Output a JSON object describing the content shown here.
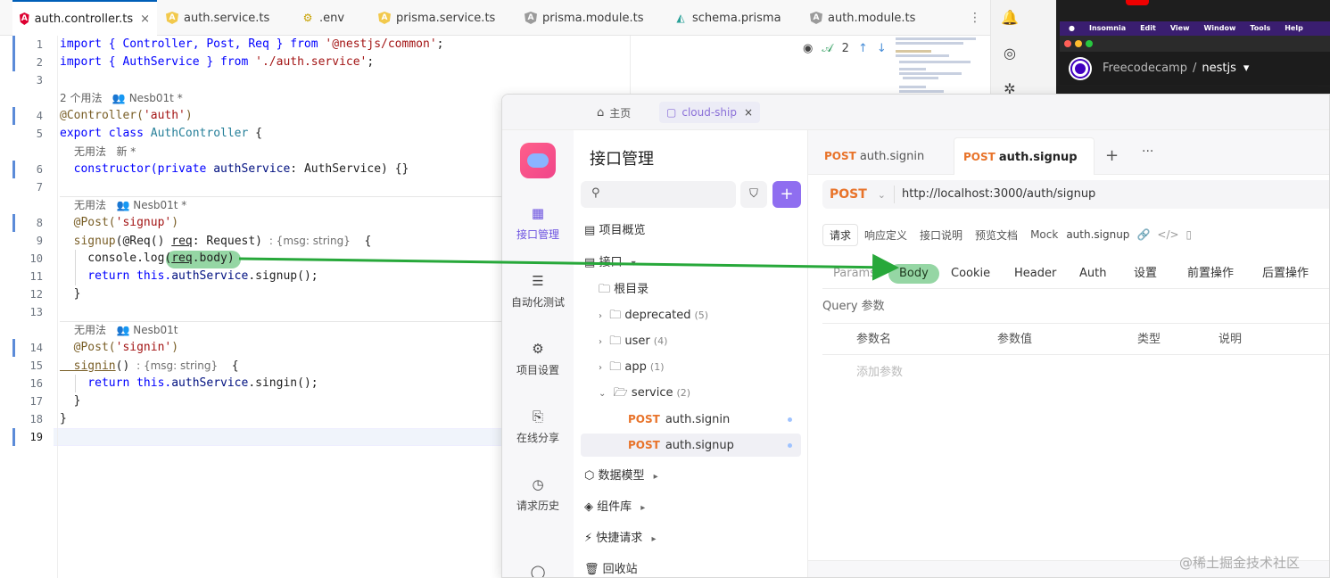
{
  "editor": {
    "tabs": [
      {
        "label": "auth.controller.ts",
        "icon": "angular-icon",
        "active": true
      },
      {
        "label": "auth.service.ts",
        "icon": "angular-service-icon"
      },
      {
        "label": ".env",
        "icon": "env-icon"
      },
      {
        "label": "prisma.service.ts",
        "icon": "angular-service-icon"
      },
      {
        "label": "prisma.module.ts",
        "icon": "angular-module-icon"
      },
      {
        "label": "schema.prisma",
        "icon": "prisma-icon"
      },
      {
        "label": "auth.module.ts",
        "icon": "angular-module-icon"
      }
    ],
    "close_glyph": "×",
    "more_glyph": "⋮",
    "line_numbers": [
      "1",
      "2",
      "3",
      "4",
      "5",
      "6",
      "7",
      "8",
      "9",
      "10",
      "11",
      "12",
      "13",
      "14",
      "15",
      "16",
      "17",
      "18",
      "19"
    ],
    "lines": {
      "l1_a": "import { Controller, Post, Req } ",
      "l1_b": "from",
      "l1_c": " '@nestjs/common'",
      "l1_d": ";",
      "l2_a": "import { AuthService } ",
      "l2_b": "from",
      "l2_c": " './auth.service'",
      "l2_d": ";",
      "l4_a": "@Controller(",
      "l4_b": "'auth'",
      "l4_c": ")",
      "l5_a": "export class ",
      "l5_b": "AuthController",
      "l5_c": " {",
      "l6_a": "  constructor(",
      "l6_b": "private ",
      "l6_c": "authService",
      "l6_d": ": AuthService) {}",
      "l8_a": "  @Post(",
      "l8_b": "'signup'",
      "l8_c": ")",
      "l9_a": "  signup",
      "l9_b": "(@Req() ",
      "l9_c": "req",
      "l9_d": ": Request) ",
      "l9_hint": ": {msg: string}",
      "l9_e": "  {",
      "l10_a": "    console.log(",
      "l10_b": "req",
      "l10_c": ".body)",
      "l11_a": "    return this.",
      "l11_b": "authService",
      "l11_c": ".signup();",
      "l12": "  }",
      "l14_a": "  @Post(",
      "l14_b": "'signin'",
      "l14_c": ")",
      "l15_a": "  signin",
      "l15_b": "() ",
      "l15_hint": ": {msg: string}",
      "l15_c": "  {",
      "l16_a": "    return this.",
      "l16_b": "authService",
      "l16_c": ".singin();",
      "l17": "  }",
      "l18": "}"
    },
    "codelens": {
      "c1_usages": "2 个用法",
      "c1_author": "Nesb01t *",
      "c2_usages": "无用法",
      "c2_new": "新 *",
      "c3_usages": "无用法",
      "c3_author": "Nesb01t *",
      "c4_usages": "无用法",
      "c4_author": "Nesb01t"
    },
    "toolbar": {
      "count": "2"
    }
  },
  "insomnia": {
    "menu": [
      "Insomnia",
      "Edit",
      "View",
      "Window",
      "Tools",
      "Help"
    ],
    "org": "Freecodecamp",
    "slash": "/",
    "project": "nestjs",
    "caret": "▾"
  },
  "apifox": {
    "home_tab": "主页",
    "project_tab": "cloud-ship",
    "project_tab_close": "×",
    "nav": [
      {
        "label": "接口管理",
        "icon": "api-management-icon",
        "active": true
      },
      {
        "label": "自动化测试",
        "icon": "automation-test-icon"
      },
      {
        "label": "项目设置",
        "icon": "project-settings-icon"
      },
      {
        "label": "在线分享",
        "icon": "online-share-icon"
      },
      {
        "label": "请求历史",
        "icon": "request-history-icon"
      }
    ],
    "tree_title": "接口管理",
    "tree": {
      "overview": "项目概览",
      "apis": "接口",
      "root": "根目录",
      "deprecated": "deprecated",
      "deprecated_count": "(5)",
      "user": "user",
      "user_count": "(4)",
      "app": "app",
      "app_count": "(1)",
      "service": "service",
      "service_count": "(2)",
      "signin_method": "POST",
      "signin": "auth.signin",
      "signup_method": "POST",
      "signup": "auth.signup",
      "models": "数据模型",
      "components": "组件库",
      "quick": "快捷请求",
      "trash": "回收站"
    },
    "req_tabs": [
      {
        "method": "POST",
        "name": "auth.signin"
      },
      {
        "method": "POST",
        "name": "auth.signup",
        "active": true
      }
    ],
    "url": {
      "method": "POST",
      "value": "http://localhost:3000/auth/signup"
    },
    "sub_tabs": [
      "请求",
      "响应定义",
      "接口说明",
      "预览文档",
      "Mock"
    ],
    "sub_name": "auth.signup",
    "param_tabs": [
      "Params",
      "Body",
      "Cookie",
      "Header",
      "Auth",
      "设置",
      "前置操作",
      "后置操作"
    ],
    "query_label": "Query 参数",
    "table_headers": [
      "参数名",
      "参数值",
      "类型",
      "说明"
    ],
    "add_param": "添加参数"
  },
  "watermark": "@稀土掘金技术社区",
  "colors": {
    "accent": "#6c52e0",
    "post": "#e8732a",
    "highlight": "#3eb45a",
    "arrow": "#27a83a"
  }
}
